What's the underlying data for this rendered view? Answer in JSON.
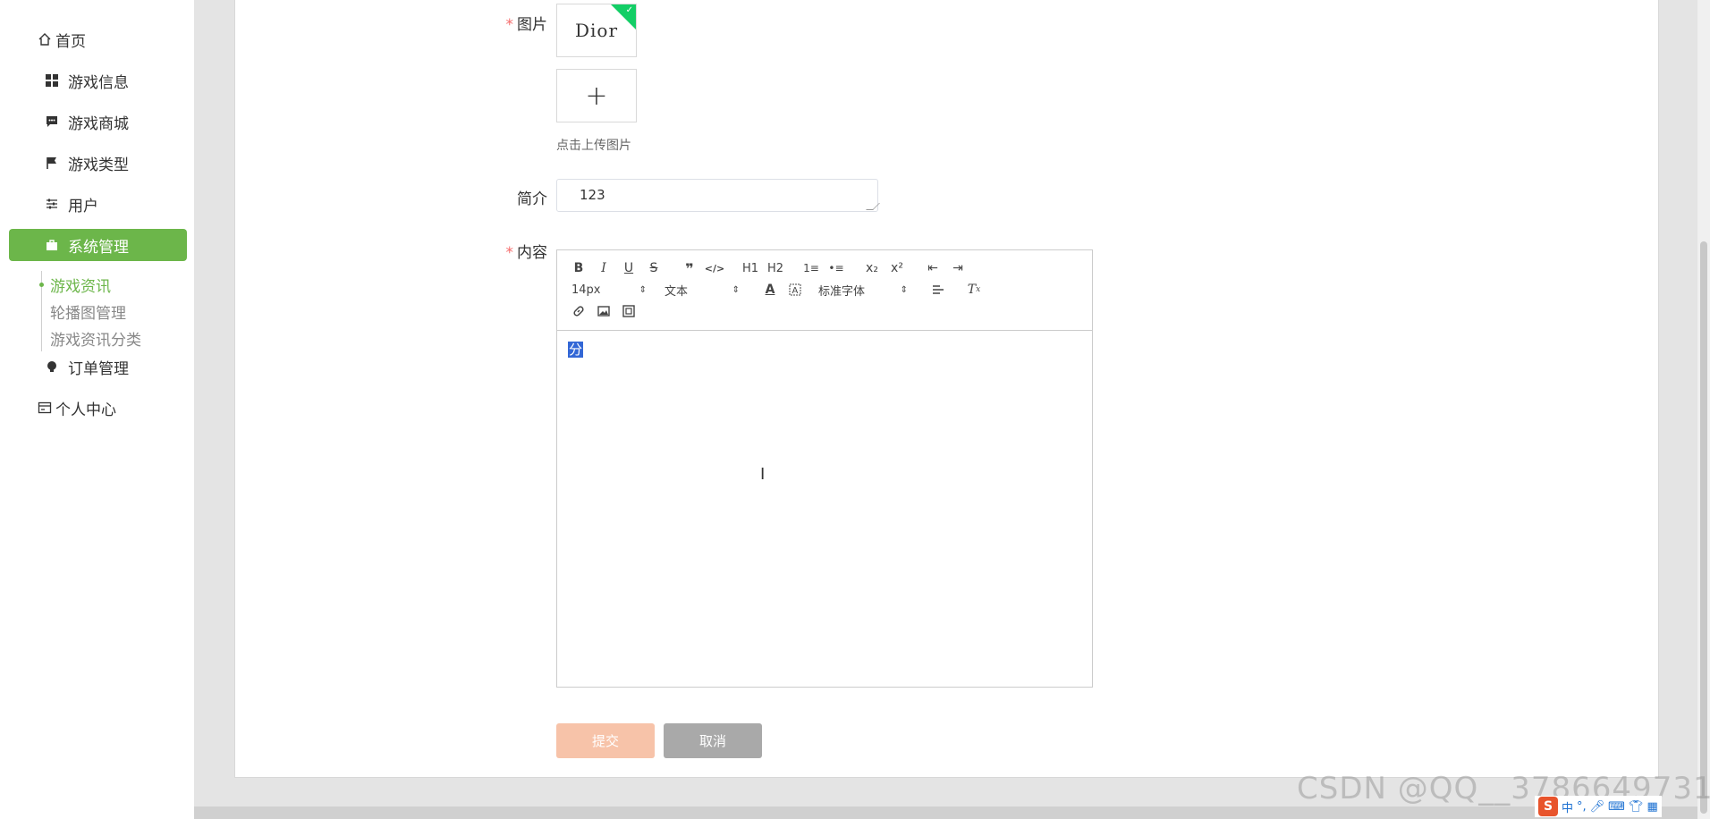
{
  "sidebar": {
    "home": {
      "label": "首页",
      "icon": "home-icon"
    },
    "items": [
      {
        "label": "游戏信息",
        "icon": "grid-icon"
      },
      {
        "label": "游戏商城",
        "icon": "chat-icon"
      },
      {
        "label": "游戏类型",
        "icon": "flag-icon"
      },
      {
        "label": "用户",
        "icon": "sliders-icon"
      },
      {
        "label": "系统管理",
        "icon": "briefcase-icon",
        "active": true
      },
      {
        "label": "订单管理",
        "icon": "bulb-icon"
      }
    ],
    "submenu": [
      {
        "label": "游戏资讯",
        "active": true
      },
      {
        "label": "轮播图管理"
      },
      {
        "label": "游戏资讯分类"
      }
    ],
    "profile": {
      "label": "个人中心",
      "icon": "id-card-icon"
    },
    "accent_color": "#6cb64a"
  },
  "form": {
    "image_label": "图片",
    "image_logo_text": "Dior",
    "upload_plus": "+",
    "upload_tip": "点击上传图片",
    "intro_label": "简介",
    "intro_value": "123",
    "content_label": "内容",
    "required_mark": "*"
  },
  "editor": {
    "font_size": "14px",
    "block_format": "文本",
    "font_family": "标准字体",
    "selected_text": "分",
    "toolbar_row1": [
      "B",
      "I",
      "U",
      "S",
      "❞",
      "</>",
      "H1",
      "H2",
      "1≡",
      "•≡",
      "x₂",
      "x²",
      "⇤",
      "⇥"
    ],
    "toolbar_row3": [
      "link",
      "image",
      "video"
    ]
  },
  "buttons": {
    "submit": "提交",
    "cancel": "取消"
  },
  "watermark": "CSDN @QQ__3786649731",
  "ime": {
    "logo": "S",
    "mode": "中"
  }
}
